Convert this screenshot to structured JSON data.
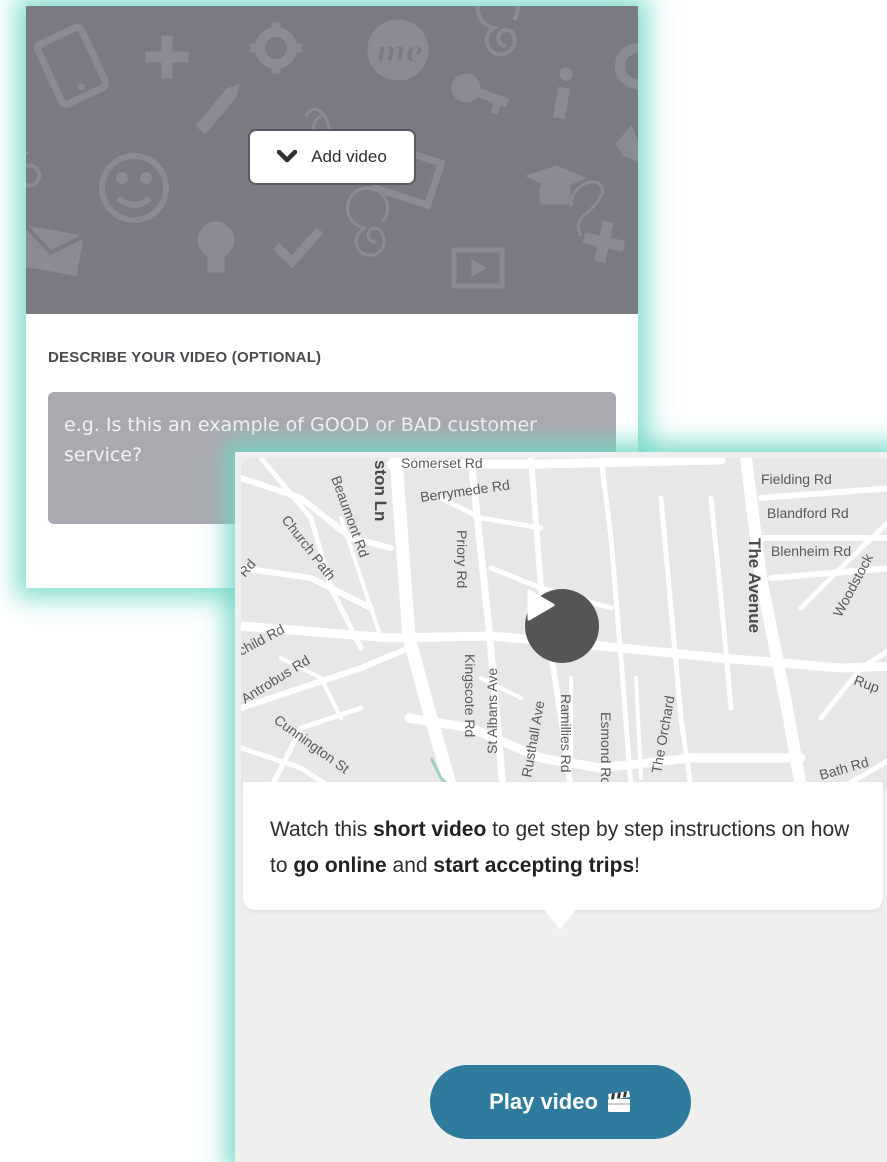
{
  "upload_card": {
    "add_video_label": "Add video",
    "doodle_text": "me",
    "describe_label": "DESCRIBE YOUR VIDEO (OPTIONAL)",
    "describe_placeholder": "e.g. Is this an example of GOOD or BAD customer service?"
  },
  "tutorial_card": {
    "map_labels": {
      "somerset": "Somerset Rd",
      "berrymede": "Berrymede Rd",
      "fielding": "Fielding Rd",
      "blandford": "Blandford Rd",
      "blenheim": "Blenheim Rd",
      "the_avenue": "The Avenue",
      "woodstock": "Woodstock",
      "beaumont": "Beaumont Rd",
      "ston_ln": "ston Ln",
      "church_path": "Church Path",
      "priory": "Priory Rd",
      "rd_left": "Rd",
      "child_rd": "child Rd",
      "antrobus": "Antrobus Rd",
      "cunnington": "Cunnington St",
      "kingscote": "Kingscote Rd",
      "st_albans": "St Albans Ave",
      "rusthall": "Rusthall Ave",
      "ramillies": "Ramillies Rd",
      "esmond": "Esmond Rd",
      "the_orchard": "The Orchard",
      "bath": "Bath Rd",
      "rup": "Rup"
    },
    "message": {
      "part1": "Watch this ",
      "bold1": "short video",
      "part2": " to get step by step instructions on how to ",
      "bold2": "go online",
      "part3": " and ",
      "bold3": "start accepting trips",
      "part4": "!"
    },
    "play_button_label": "Play video"
  },
  "colors": {
    "banner_bg": "#7b7a83",
    "input_bg": "#aaa9b0",
    "play_button_bg": "#2f7b9e",
    "glow": "#6ed7c8"
  },
  "icons": {
    "chevron": "chevron-down-icon",
    "play": "play-icon",
    "clapper": "clapperboard-icon"
  }
}
